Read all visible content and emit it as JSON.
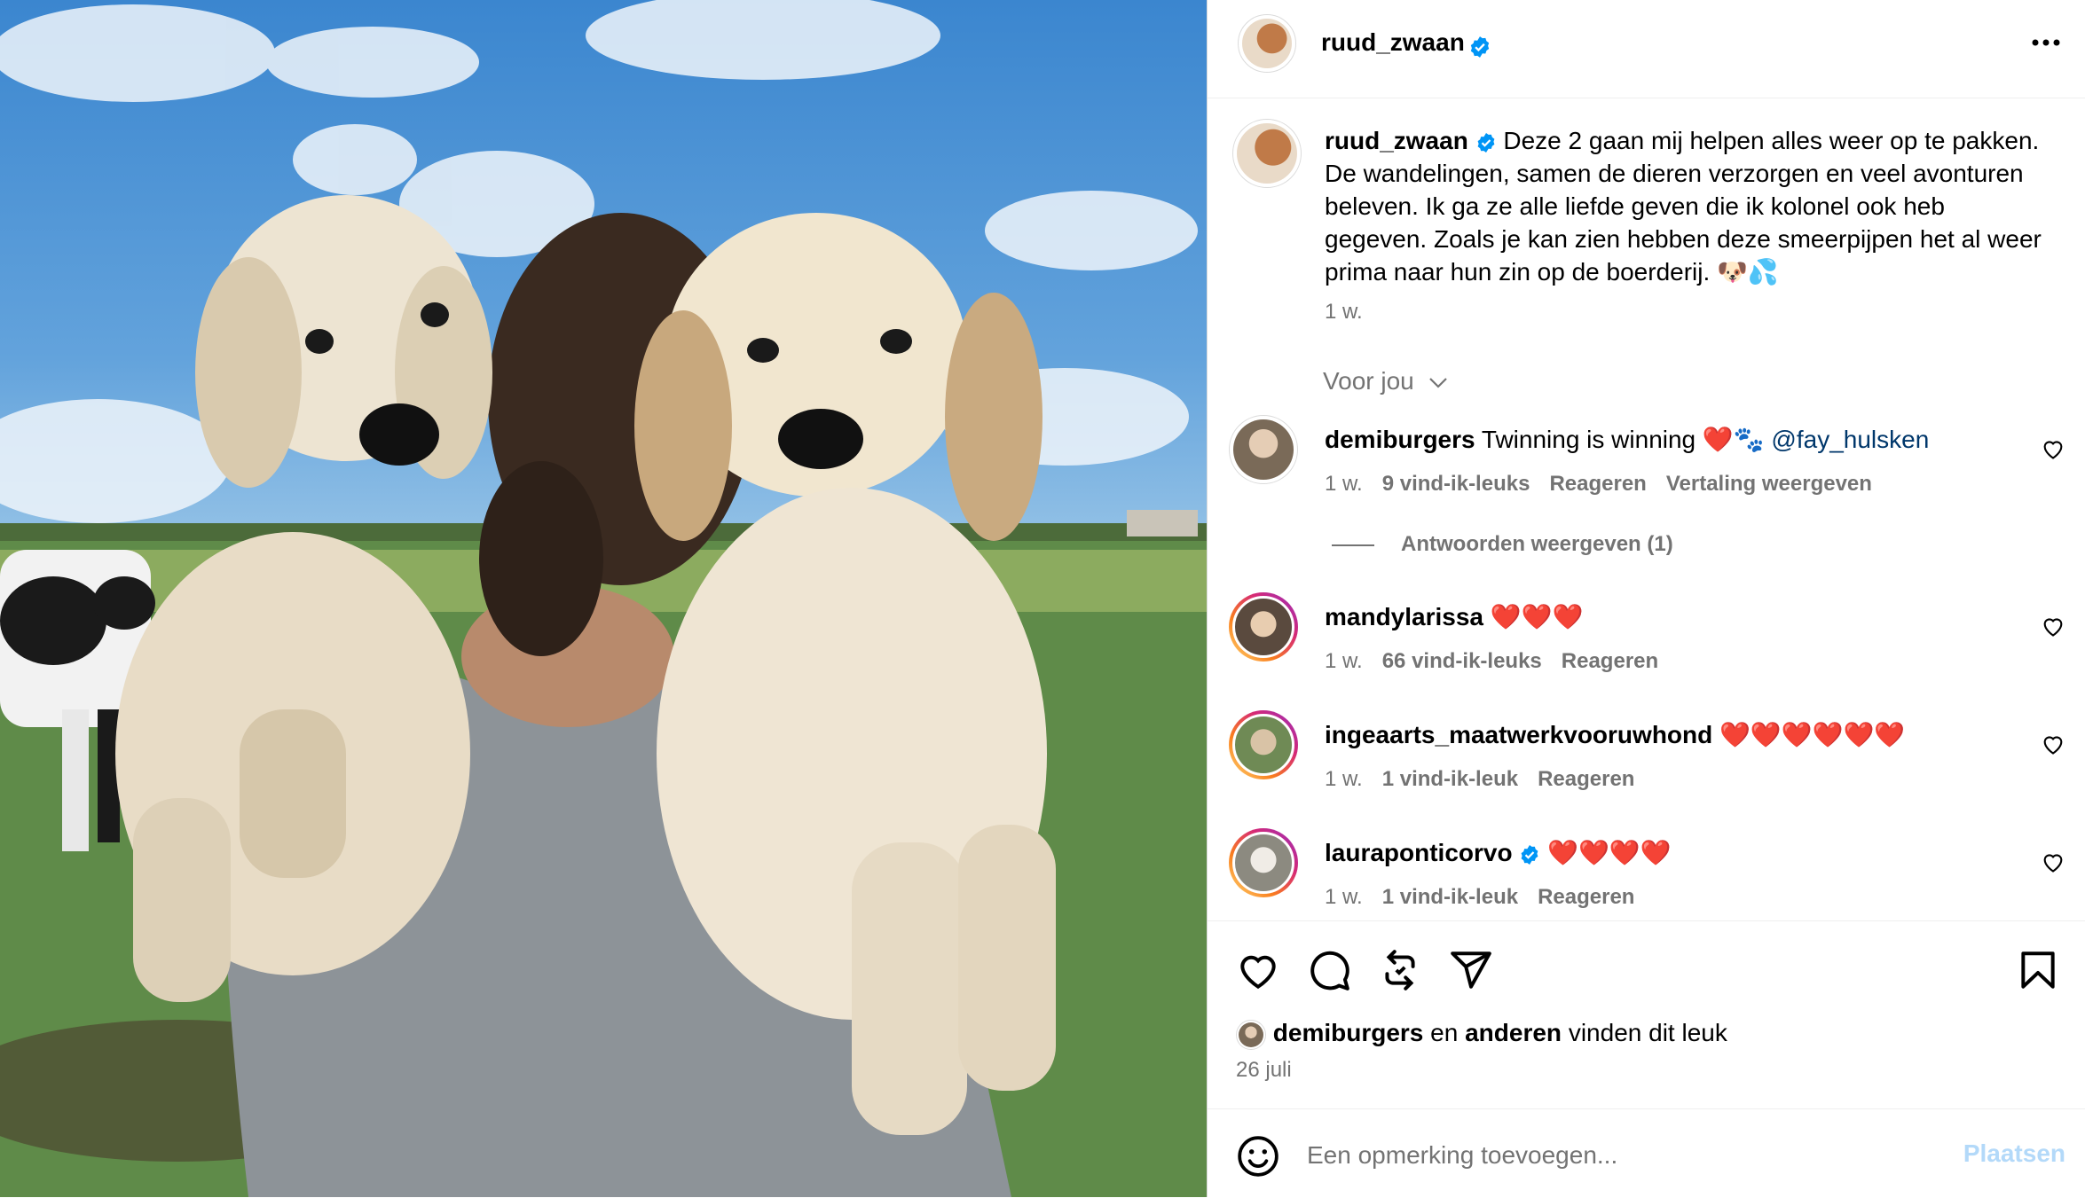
{
  "post": {
    "author": "ruud_zwaan",
    "verified": true,
    "caption": "Deze 2 gaan mij helpen alles weer op te pakken. De wandelingen, samen de dieren verzorgen en veel avonturen beleven. Ik ga ze alle liefde geven die ik kolonel ook heb gegeven. Zoals je kan zien hebben deze smeerpijpen het al weer prima naar hun zin op de boerderij. 🐶💦",
    "caption_time": "1 w.",
    "for_you_label": "Voor jou"
  },
  "comments": [
    {
      "user": "demiburgers",
      "verified": false,
      "text": "Twinning is winning ❤️🐾",
      "mention": "@fay_hulsken",
      "time": "1 w.",
      "likes": "9 vind-ik-leuks",
      "reply": "Reageren",
      "translate": "Vertaling weergeven"
    },
    {
      "user": "mandylarissa",
      "verified": false,
      "text": "❤️❤️❤️",
      "time": "1 w.",
      "likes": "66 vind-ik-leuks",
      "reply": "Reageren"
    },
    {
      "user": "ingeaarts_maatwerkvooruwhond",
      "verified": false,
      "text": "❤️❤️❤️❤️❤️❤️",
      "time": "1 w.",
      "likes": "1 vind-ik-leuk",
      "reply": "Reageren"
    },
    {
      "user": "lauraponticorvo",
      "verified": true,
      "text": "❤️❤️❤️❤️",
      "time": "1 w.",
      "likes": "1 vind-ik-leuk",
      "reply": "Reageren"
    }
  ],
  "view_replies": "Antwoorden weergeven (1)",
  "likes_line": {
    "user": "demiburgers",
    "connector": "en",
    "others": "anderen",
    "suffix": "vinden dit leuk"
  },
  "date": "26 juli",
  "add_comment": {
    "placeholder": "Een opmerking toevoegen...",
    "post_label": "Plaatsen"
  },
  "colors": {
    "verified": "#0095f6",
    "muted": "#737373",
    "post_disabled": "#b3d9f9",
    "link": "#00376b"
  },
  "icons": [
    "more-icon",
    "heart-icon",
    "comment-icon",
    "repost-icon",
    "share-icon",
    "bookmark-icon",
    "emoji-icon",
    "verified-icon",
    "chevron-down-icon"
  ]
}
